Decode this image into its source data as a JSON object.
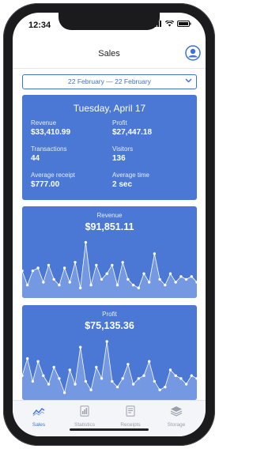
{
  "status": {
    "time": "12:34"
  },
  "nav": {
    "title": "Sales"
  },
  "date_range": {
    "label": "22 February — 22 February"
  },
  "summary": {
    "date": "Tuesday, April 17",
    "metrics": [
      {
        "label": "Revenue",
        "value": "$33,410.99"
      },
      {
        "label": "Profit",
        "value": "$27,447.18"
      },
      {
        "label": "Transactions",
        "value": "44"
      },
      {
        "label": "Visitors",
        "value": "136"
      },
      {
        "label": "Average receipt",
        "value": "$777.00"
      },
      {
        "label": "Average time",
        "value": "2 sec"
      }
    ]
  },
  "charts": [
    {
      "title": "Revenue",
      "value": "$91,851.11"
    },
    {
      "title": "Profit",
      "value": "$75,135.36"
    }
  ],
  "chart_data": [
    {
      "type": "area",
      "values": [
        0.45,
        0.2,
        0.45,
        0.5,
        0.25,
        0.55,
        0.3,
        0.2,
        0.5,
        0.25,
        0.6,
        0.15,
        0.95,
        0.2,
        0.55,
        0.3,
        0.4,
        0.55,
        0.2,
        0.6,
        0.3,
        0.2,
        0.15,
        0.4,
        0.25,
        0.75,
        0.3,
        0.2,
        0.4,
        0.25,
        0.35,
        0.3,
        0.35,
        0.25
      ]
    },
    {
      "type": "area",
      "values": [
        0.4,
        0.7,
        0.3,
        0.65,
        0.4,
        0.25,
        0.55,
        0.35,
        0.1,
        0.5,
        0.25,
        0.9,
        0.3,
        0.15,
        0.55,
        0.35,
        1.0,
        0.3,
        0.2,
        0.35,
        0.6,
        0.25,
        0.35,
        0.4,
        0.65,
        0.3,
        0.15,
        0.2,
        0.5,
        0.4,
        0.35,
        0.25,
        0.4,
        0.35
      ]
    }
  ],
  "tabs": [
    {
      "label": "Sales",
      "icon": "sales-trend-icon",
      "active": true
    },
    {
      "label": "Statistics",
      "icon": "statistics-doc-icon",
      "active": false
    },
    {
      "label": "Receipts",
      "icon": "receipt-icon",
      "active": false
    },
    {
      "label": "Storage",
      "icon": "storage-icon",
      "active": false
    }
  ],
  "colors": {
    "accent": "#3e71d6",
    "card": "#4a78d4",
    "area": "#7b9ee4",
    "phone": "#1b1b1d"
  }
}
